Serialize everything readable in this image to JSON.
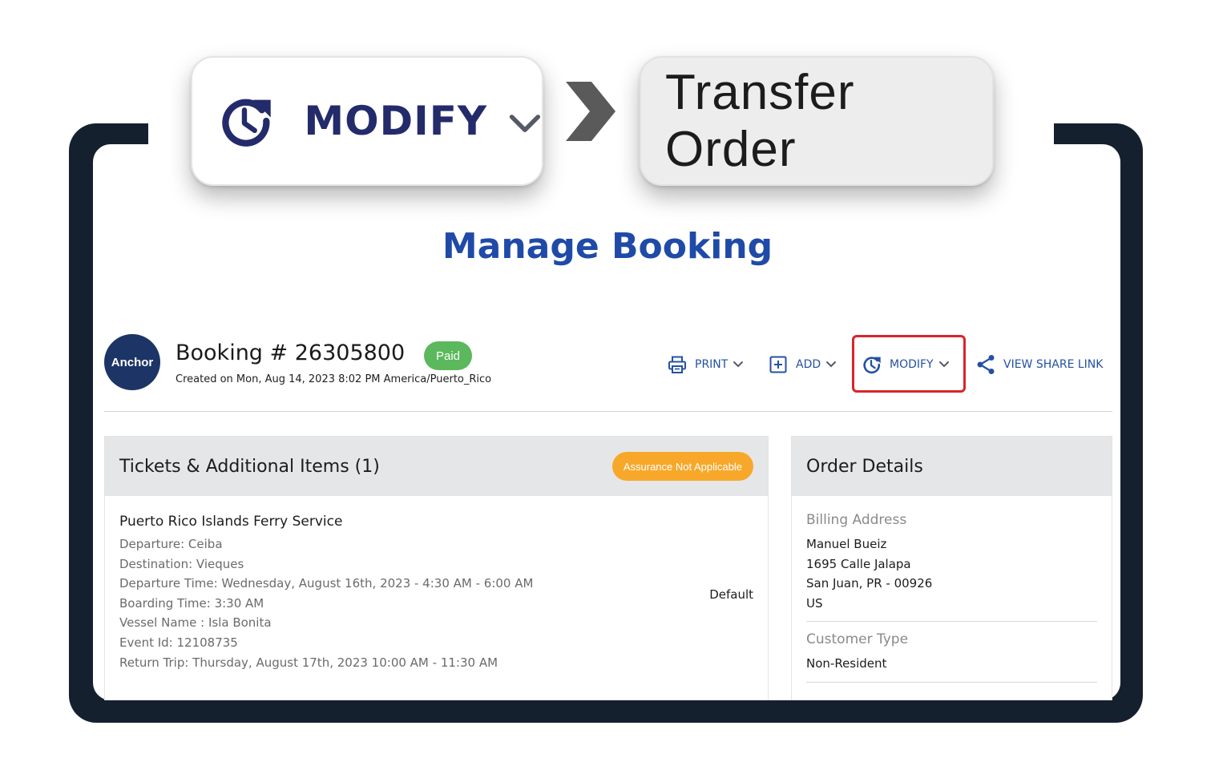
{
  "callouts": {
    "modify_label": "MODIFY",
    "transfer_label": "Transfer Order"
  },
  "page_title": "Manage Booking",
  "booking": {
    "avatar_text": "Anchor",
    "title": "Booking # 26305800",
    "status": "Paid",
    "created": "Created on Mon, Aug 14, 2023 8:02 PM America/Puerto_Rico"
  },
  "actions": {
    "print": "PRINT",
    "add": "ADD",
    "modify": "MODIFY",
    "share": "VIEW SHARE LINK"
  },
  "tickets": {
    "heading": "Tickets & Additional Items (1)",
    "assurance": "Assurance Not Applicable",
    "item_name": "Puerto Rico Islands Ferry Service",
    "lines": [
      "Departure: Ceiba",
      "Destination: Vieques",
      "Departure Time: Wednesday, August 16th, 2023 - 4:30 AM - 6:00 AM",
      "Boarding Time: 3:30 AM",
      "Vessel Name : Isla Bonita",
      "Event Id: 12108735",
      "Return Trip: Thursday, August 17th, 2023 10:00 AM - 11:30 AM"
    ],
    "fare_type": "Default"
  },
  "order_details": {
    "heading": "Order Details",
    "billing_label": "Billing Address",
    "billing_lines": [
      "Manuel Bueiz",
      "1695 Calle Jalapa",
      "San Juan, PR - 00926",
      "US"
    ],
    "customer_type_label": "Customer Type",
    "customer_type": "Non-Resident"
  },
  "colors": {
    "frame": "#15202f",
    "brand_navy": "#232b6b",
    "link_blue": "#2451a3",
    "title_blue": "#1f4aa8",
    "paid_green": "#5cb85c",
    "assurance_orange": "#f7a82a",
    "highlight_red": "#d9242b"
  },
  "icons": [
    "modify-clock-icon",
    "chevron-down-icon",
    "arrow-right-icon",
    "printer-icon",
    "add-square-icon",
    "share-icon"
  ]
}
